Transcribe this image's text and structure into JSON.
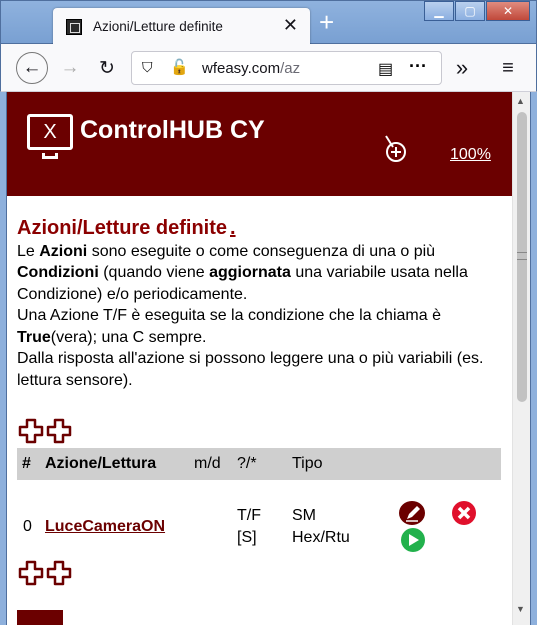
{
  "browser": {
    "tab_title": "Azioni/Letture definite",
    "url_domain": "wfeasy.com",
    "url_path": "/az"
  },
  "app": {
    "title": "ControlHUB CY",
    "zoom_label": "100%",
    "brand_color": "#6b0000"
  },
  "section": {
    "title": "Azioni/Letture definite",
    "title_suffix": ".",
    "title_color": "#8b0000",
    "p1_a": "Le ",
    "p1_b": "Azioni",
    "p1_c": " sono eseguite o come conseguenza di una o più ",
    "p1_d": "Condizioni",
    "p1_e": " (quando viene ",
    "p1_f": "aggiornata",
    "p1_g": " una variabile usata nella Condizione) e/o periodicamente.",
    "p2_a": "Una Azione T/F è eseguita se la condizione che la chiama è ",
    "p2_b": "True",
    "p2_c": "(vera); una C sempre.",
    "p3": "Dalla risposta all'azione si possono leggere una o più variabili (es. lettura sensore)."
  },
  "table": {
    "headers": {
      "num": "#",
      "name": "Azione/Lettura",
      "md": "m/d",
      "q": "?/*",
      "tipo": "Tipo"
    },
    "rows": [
      {
        "num": "0",
        "name": "LuceCameraON",
        "type_line1": "T/F",
        "type_line2": "[S]",
        "tipo_line1": "SM",
        "tipo_line2": "Hex/Rtu"
      }
    ]
  },
  "icons": {
    "add": "add-icon",
    "edit": "edit-icon",
    "delete": "delete-icon",
    "run": "play-icon"
  }
}
